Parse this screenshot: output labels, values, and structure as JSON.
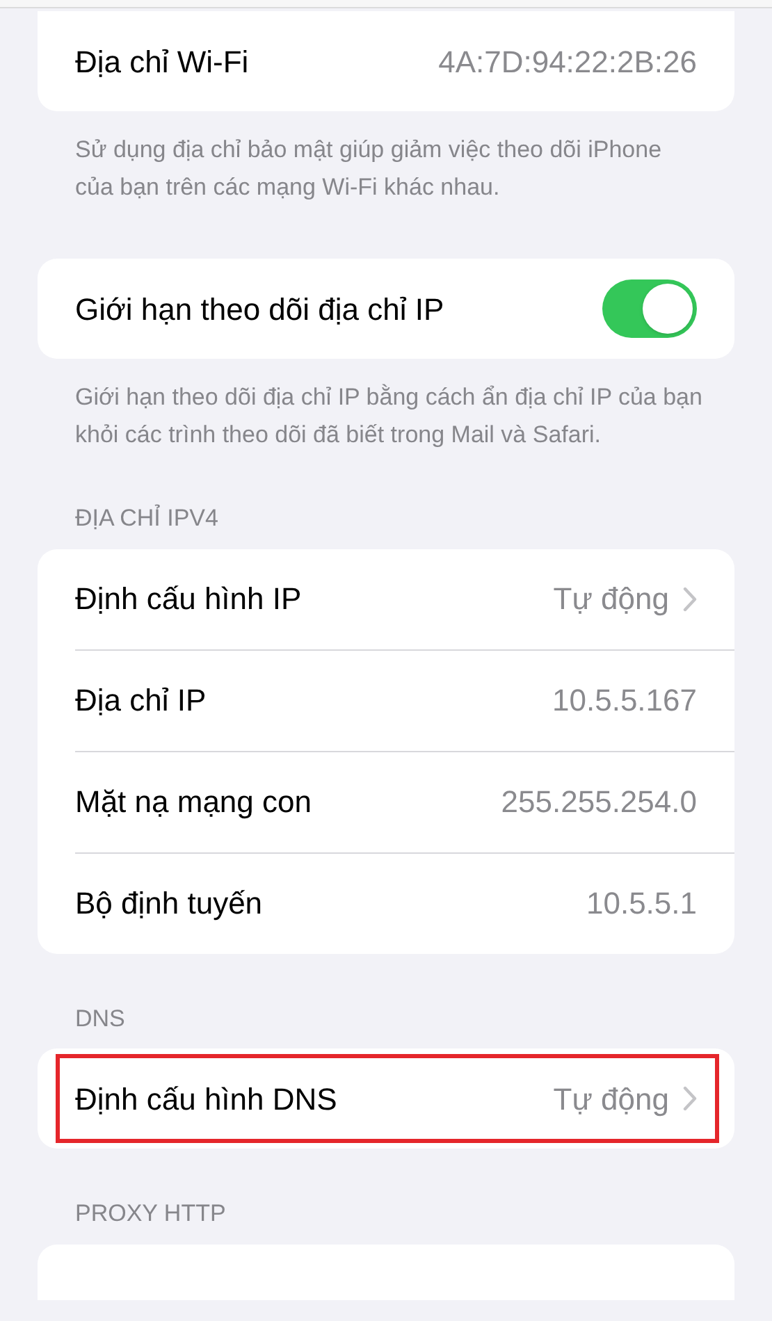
{
  "sections": [
    {
      "cut_top": true,
      "rows": [
        {
          "kind": "value",
          "label": "Địa chỉ Wi-Fi",
          "value": "4A:7D:94:22:2B:26",
          "highlighted": false
        }
      ],
      "footer": "Sử dụng địa chỉ bảo mật giúp giảm việc theo dõi iPhone của bạn trên các mạng Wi-Fi khác nhau."
    },
    {
      "cut_top": false,
      "rows": [
        {
          "kind": "toggle",
          "label": "Giới hạn theo dõi địa chỉ IP",
          "on": true,
          "highlighted": false
        }
      ],
      "footer": "Giới hạn theo dõi địa chỉ IP bằng cách ẩn địa chỉ IP của bạn khỏi các trình theo dõi đã biết trong Mail và Safari."
    },
    {
      "header": "ĐỊA CHỈ IPV4",
      "cut_top": false,
      "rows": [
        {
          "kind": "link",
          "label": "Định cấu hình IP",
          "value": "Tự động",
          "highlighted": false
        },
        {
          "kind": "value",
          "label": "Địa chỉ IP",
          "value": "10.5.5.167",
          "highlighted": false
        },
        {
          "kind": "value",
          "label": "Mặt nạ mạng con",
          "value": "255.255.254.0",
          "highlighted": false
        },
        {
          "kind": "value",
          "label": "Bộ định tuyến",
          "value": "10.5.5.1",
          "highlighted": false
        }
      ]
    },
    {
      "header": "DNS",
      "cut_top": false,
      "rows": [
        {
          "kind": "link",
          "label": "Định cấu hình DNS",
          "value": "Tự động",
          "highlighted": true
        }
      ]
    },
    {
      "header": "PROXY HTTP",
      "cut_top": false
    }
  ]
}
